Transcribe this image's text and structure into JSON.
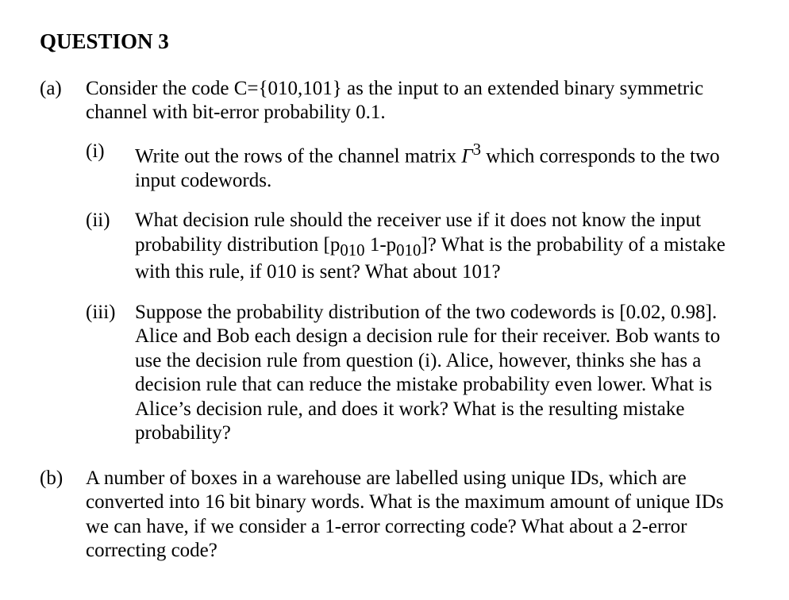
{
  "heading": "QUESTION 3",
  "a": {
    "label": "(a)",
    "stem": "Consider the code C={010,101} as the input to an extended binary symmetric channel with bit-error probability 0.1.",
    "i": {
      "label": "(i)",
      "t1": "Write out the rows of the channel matrix ",
      "gamma": "Γ",
      "exp": "3",
      "t2": " which corresponds to the two input codewords."
    },
    "ii": {
      "label": "(ii)",
      "t1": "What decision rule should the receiver use if it does not know the input probability distribution [p",
      "s1": "010",
      "t2": " 1-p",
      "s2": "010",
      "t3": "]? What is the probability of a mistake with this rule, if 010 is sent? What about 101?"
    },
    "iii": {
      "label": "(iii)",
      "text": "Suppose the probability distribution of the two codewords is [0.02, 0.98]. Alice and Bob each design a decision rule for their receiver. Bob wants to use the decision rule from question (i). Alice, however, thinks she has a decision rule that can reduce the mistake probability even lower. What is Alice’s decision rule, and does it work? What is the resulting mistake probability?"
    }
  },
  "b": {
    "label": "(b)",
    "text": "A number of boxes in a warehouse are labelled using unique IDs, which are converted into 16 bit binary words. What is the maximum amount of unique IDs we can have, if we consider a 1-error correcting code? What about a 2-error correcting code?"
  }
}
